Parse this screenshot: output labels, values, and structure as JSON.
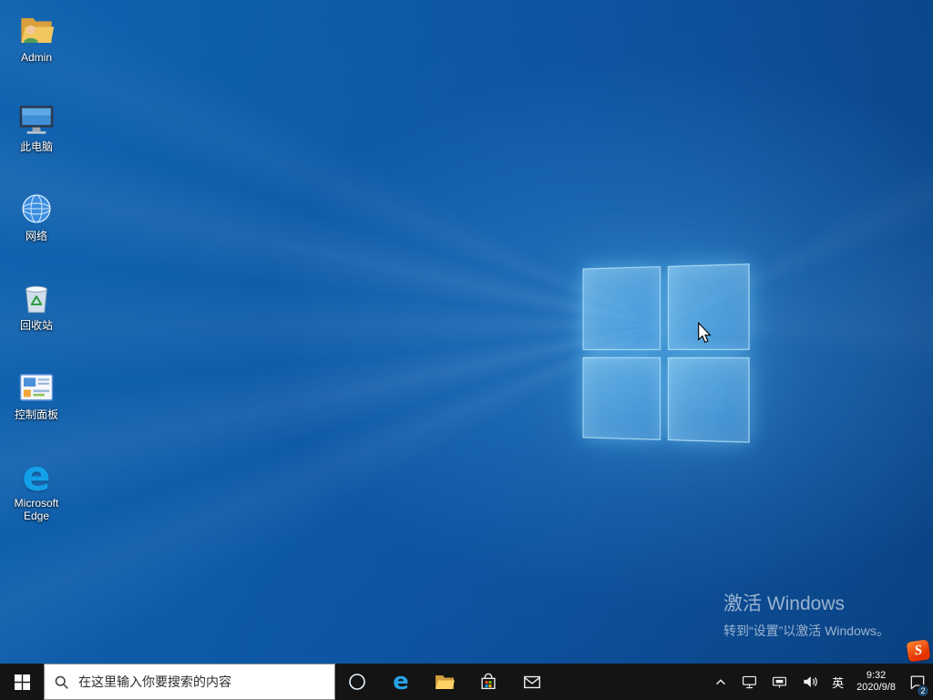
{
  "desktop": {
    "icons": [
      {
        "label": "Admin",
        "icon": "user-folder-icon"
      },
      {
        "label": "此电脑",
        "icon": "this-pc-icon"
      },
      {
        "label": "网络",
        "icon": "network-globe-icon"
      },
      {
        "label": "回收站",
        "icon": "recycle-bin-icon"
      },
      {
        "label": "控制面板",
        "icon": "control-panel-icon"
      },
      {
        "label": "Microsoft Edge",
        "icon": "edge-icon"
      }
    ],
    "activation_watermark": {
      "title": "激活 Windows",
      "subtitle": "转到“设置”以激活 Windows。"
    }
  },
  "glyphs": {
    "edge_e": "e",
    "sogou_s": "S"
  },
  "taskbar": {
    "search": {
      "placeholder": "在这里输入你要搜索的内容"
    },
    "pinned_icons": [
      "cortana-icon",
      "edge-icon",
      "file-explorer-icon",
      "store-icon",
      "mail-icon"
    ],
    "tray": {
      "ime": "英",
      "time": "9:32",
      "date": "2020/9/8",
      "notification_badge": "2"
    }
  }
}
